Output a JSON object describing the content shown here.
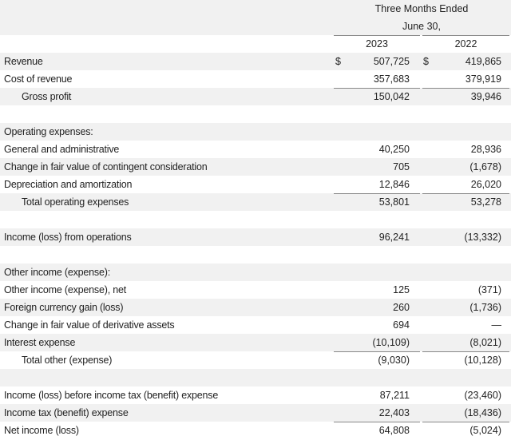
{
  "header": {
    "period_line1": "Three Months Ended",
    "period_line2": "June 30,",
    "col1_year": "2023",
    "col2_year": "2022",
    "currency_symbol": "$"
  },
  "rows": {
    "revenue": {
      "label": "Revenue",
      "v2023": "507,725",
      "v2022": "419,865"
    },
    "cost_of_revenue": {
      "label": "Cost of revenue",
      "v2023": "357,683",
      "v2022": "379,919"
    },
    "gross_profit": {
      "label": "Gross profit",
      "v2023": "150,042",
      "v2022": "39,946"
    },
    "opex_heading": {
      "label": "Operating expenses:"
    },
    "g_and_a": {
      "label": "General and administrative",
      "v2023": "40,250",
      "v2022": "28,936"
    },
    "contingent": {
      "label": "Change in fair value of contingent consideration",
      "v2023": "705",
      "v2022": "(1,678)"
    },
    "d_and_a": {
      "label": "Depreciation and amortization",
      "v2023": "12,846",
      "v2022": "26,020"
    },
    "total_opex": {
      "label": "Total operating expenses",
      "v2023": "53,801",
      "v2022": "53,278"
    },
    "income_ops": {
      "label": "Income (loss) from operations",
      "v2023": "96,241",
      "v2022": "(13,332)"
    },
    "other_heading": {
      "label": "Other income (expense):"
    },
    "other_net": {
      "label": "Other income (expense), net",
      "v2023": "125",
      "v2022": "(371)"
    },
    "fx": {
      "label": "Foreign currency gain (loss)",
      "v2023": "260",
      "v2022": "(1,736)"
    },
    "derivative": {
      "label": "Change in fair value of derivative assets",
      "v2023": "694",
      "v2022": "—"
    },
    "interest": {
      "label": "Interest expense",
      "v2023": "(10,109)",
      "v2022": "(8,021)"
    },
    "total_other": {
      "label": "Total other (expense)",
      "v2023": "(9,030)",
      "v2022": "(10,128)"
    },
    "pretax": {
      "label": "Income (loss) before income tax (benefit) expense",
      "v2023": "87,211",
      "v2022": "(23,460)"
    },
    "tax": {
      "label": "Income tax (benefit) expense",
      "v2023": "22,403",
      "v2022": "(18,436)"
    },
    "net_income": {
      "label": "Net income (loss)",
      "v2023": "64,808",
      "v2022": "(5,024)"
    }
  }
}
